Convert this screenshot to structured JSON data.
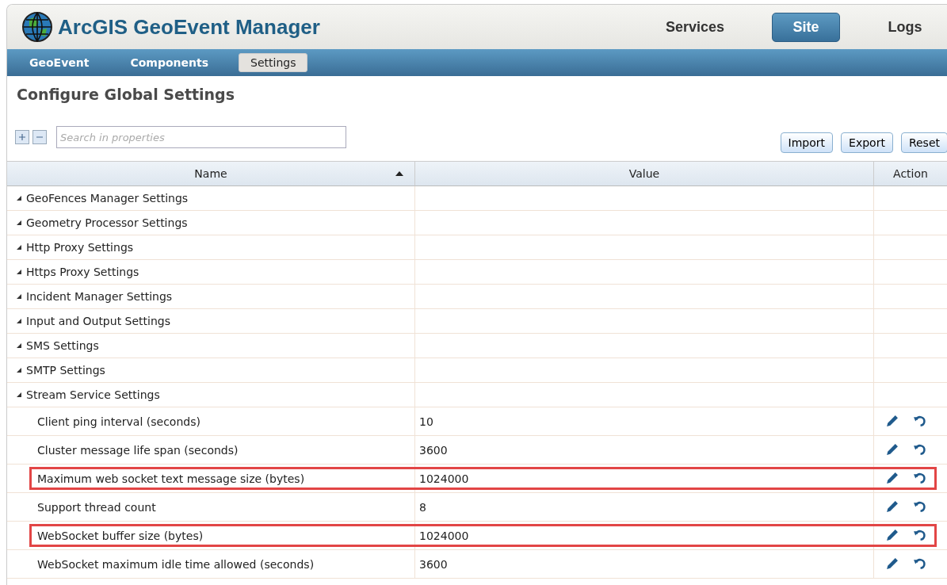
{
  "header": {
    "title": "ArcGIS GeoEvent Manager",
    "nav": [
      {
        "label": "Services",
        "selected": false
      },
      {
        "label": "Site",
        "selected": true
      },
      {
        "label": "Logs",
        "selected": false
      }
    ]
  },
  "subnav": [
    {
      "label": "GeoEvent",
      "selected": false
    },
    {
      "label": "Components",
      "selected": false
    },
    {
      "label": "Settings",
      "selected": true
    }
  ],
  "page_title": "Configure Global Settings",
  "search": {
    "placeholder": "Search in properties"
  },
  "buttons": [
    "Import",
    "Export",
    "Reset"
  ],
  "table": {
    "columns": [
      "Name",
      "Value",
      "Action"
    ],
    "rows": [
      {
        "name": "GeoFences Manager Settings",
        "children": []
      },
      {
        "name": "Geometry Processor Settings",
        "children": []
      },
      {
        "name": "Http Proxy Settings",
        "children": []
      },
      {
        "name": "Https Proxy Settings",
        "children": []
      },
      {
        "name": "Incident Manager Settings",
        "children": []
      },
      {
        "name": "Input and Output Settings",
        "children": []
      },
      {
        "name": "SMS Settings",
        "children": []
      },
      {
        "name": "SMTP Settings",
        "children": []
      },
      {
        "name": "Stream Service Settings",
        "children": [
          {
            "name": "Client ping interval (seconds)",
            "value": "10",
            "highlighted": false
          },
          {
            "name": "Cluster message life span (seconds)",
            "value": "3600",
            "highlighted": false
          },
          {
            "name": "Maximum web socket text message size (bytes)",
            "value": "1024000",
            "highlighted": true
          },
          {
            "name": "Support thread count",
            "value": "8",
            "highlighted": false
          },
          {
            "name": "WebSocket buffer size (bytes)",
            "value": "1024000",
            "highlighted": true
          },
          {
            "name": "WebSocket maximum idle time allowed (seconds)",
            "value": "3600",
            "highlighted": false
          }
        ]
      }
    ]
  }
}
